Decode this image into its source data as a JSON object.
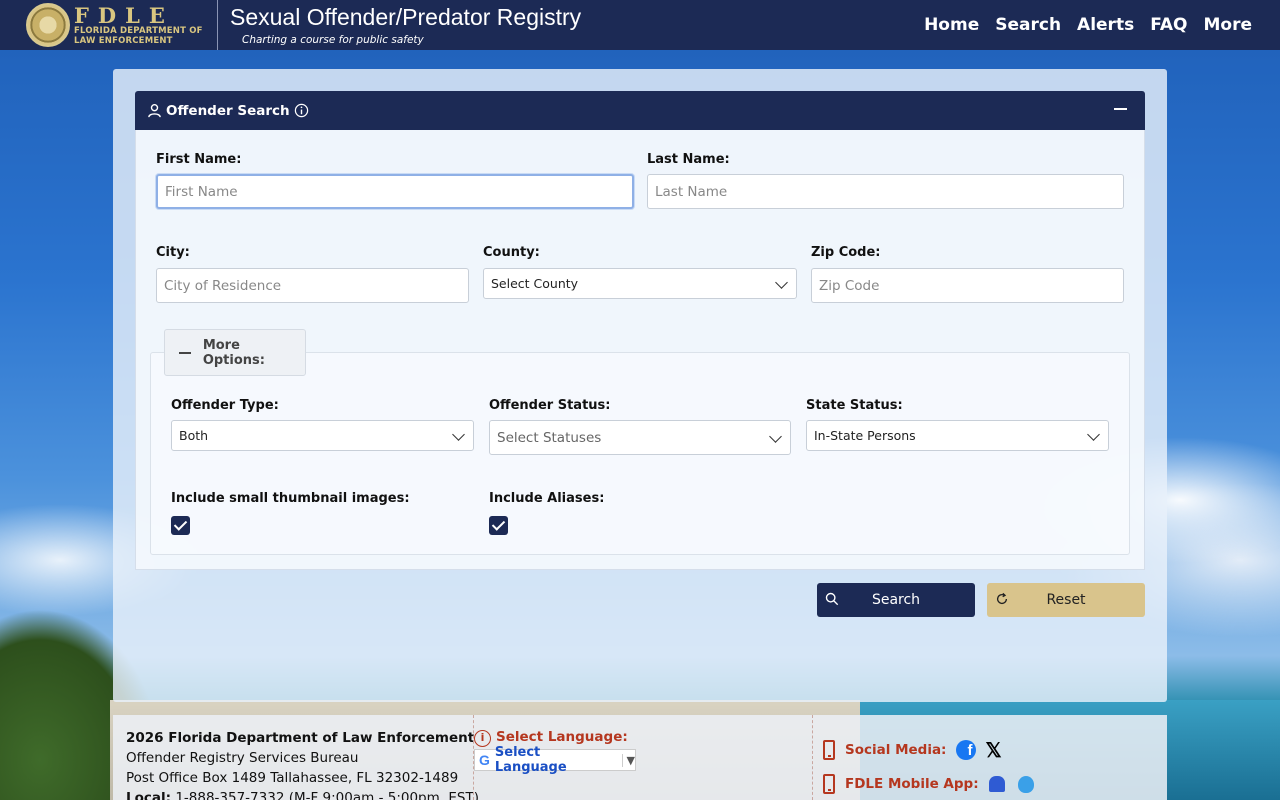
{
  "header": {
    "logo_big": "FDLE",
    "logo_line1": "FLORIDA DEPARTMENT OF",
    "logo_line2": "LAW ENFORCEMENT",
    "title": "Sexual Offender/Predator Registry",
    "tagline": "Charting a course for public safety",
    "nav": [
      "Home",
      "Search",
      "Alerts",
      "FAQ",
      "More"
    ]
  },
  "search_card": {
    "title": "Offender Search",
    "first_name": {
      "label": "First Name:",
      "placeholder": "First Name"
    },
    "last_name": {
      "label": "Last Name:",
      "placeholder": "Last Name"
    },
    "city": {
      "label": "City:",
      "placeholder": "City of Residence"
    },
    "county": {
      "label": "County:",
      "value": "Select County"
    },
    "zip": {
      "label": "Zip Code:",
      "placeholder": "Zip Code"
    },
    "more_options_label": "More Options:",
    "offender_type": {
      "label": "Offender Type:",
      "value": "Both"
    },
    "offender_status": {
      "label": "Offender Status:",
      "value": "Select Statuses"
    },
    "state_status": {
      "label": "State Status:",
      "value": "In-State Persons"
    },
    "thumbnails": {
      "label": "Include small thumbnail images:",
      "checked": true
    },
    "aliases": {
      "label": "Include Aliases:",
      "checked": true
    },
    "search_button": "Search",
    "reset_button": "Reset"
  },
  "footer": {
    "line1": "2026 Florida Department of Law Enforcement",
    "line2": "Offender Registry Services Bureau",
    "line3": "Post Office Box 1489 Tallahassee, FL 32302-1489",
    "line4_label": "Local:",
    "line4_value": "1-888-357-7332 (M-F 9:00am - 5:00pm, EST)",
    "language_label": "Select Language:",
    "language_select": "Select Language",
    "social_label": "Social Media:",
    "app_label": "FDLE Mobile App:"
  },
  "colors": {
    "navy": "#1c2a55",
    "gold": "#d9c48c",
    "accent_red": "#b5371f"
  }
}
